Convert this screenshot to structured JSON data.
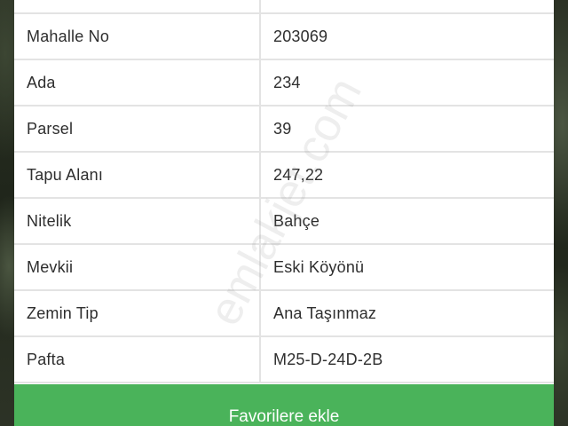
{
  "details": {
    "rows": [
      {
        "label": "",
        "value": ""
      },
      {
        "label": "Mahalle No",
        "value": "203069"
      },
      {
        "label": "Ada",
        "value": "234"
      },
      {
        "label": "Parsel",
        "value": "39"
      },
      {
        "label": "Tapu Alanı",
        "value": "247,22"
      },
      {
        "label": "Nitelik",
        "value": "Bahçe"
      },
      {
        "label": "Mevkii",
        "value": "Eski Köyönü"
      },
      {
        "label": "Zemin Tip",
        "value": "Ana Taşınmaz"
      },
      {
        "label": "Pafta",
        "value": "M25-D-24D-2B"
      }
    ]
  },
  "actions": {
    "favorite_label": "Favorilere ekle"
  },
  "watermark": {
    "text": "emlakjet.com"
  },
  "colors": {
    "button": "#4ab35a",
    "border": "#e3e3e3",
    "text": "#2e2e2e"
  }
}
